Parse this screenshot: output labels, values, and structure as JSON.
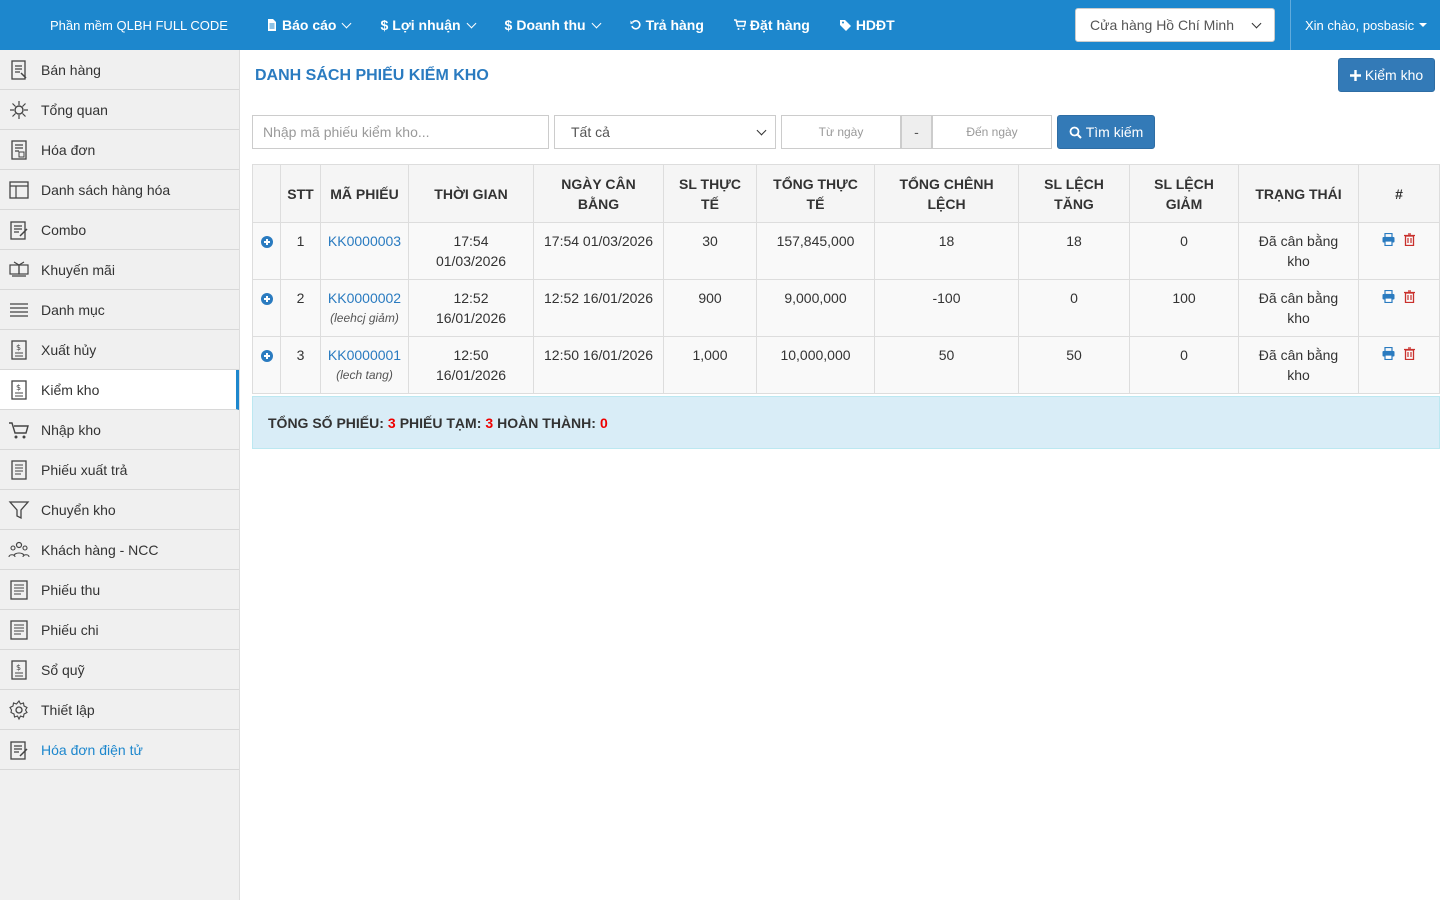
{
  "topbar": {
    "brand": "Phần mềm QLBH FULL CODE",
    "nav": [
      {
        "label": "Báo cáo",
        "icon": "file-icon",
        "dropdown": true
      },
      {
        "label": "Lợi nhuận",
        "icon": "dollar-icon",
        "dropdown": true
      },
      {
        "label": "Doanh thu",
        "icon": "dollar-icon",
        "dropdown": true
      },
      {
        "label": "Trả hàng",
        "icon": "undo-icon",
        "dropdown": false
      },
      {
        "label": "Đặt hàng",
        "icon": "cart-icon",
        "dropdown": false
      },
      {
        "label": "HDĐT",
        "icon": "tag-icon",
        "dropdown": false
      }
    ],
    "store": "Cửa hàng Hồ Chí Minh",
    "greeting": "Xin chào, posbasic"
  },
  "sidebar": {
    "items": [
      {
        "label": "Bán hàng",
        "icon": "sales-icon"
      },
      {
        "label": "Tổng quan",
        "icon": "overview-icon"
      },
      {
        "label": "Hóa đơn",
        "icon": "invoice-icon"
      },
      {
        "label": "Danh sách hàng hóa",
        "icon": "products-icon"
      },
      {
        "label": "Combo",
        "icon": "combo-icon"
      },
      {
        "label": "Khuyến mãi",
        "icon": "promotion-icon"
      },
      {
        "label": "Danh mục",
        "icon": "list-icon"
      },
      {
        "label": "Xuất hủy",
        "icon": "export-cancel-icon"
      },
      {
        "label": "Kiểm kho",
        "icon": "stock-check-icon"
      },
      {
        "label": "Nhập kho",
        "icon": "stock-in-icon"
      },
      {
        "label": "Phiếu xuất trả",
        "icon": "return-slip-icon"
      },
      {
        "label": "Chuyển kho",
        "icon": "transfer-icon"
      },
      {
        "label": "Khách hàng - NCC",
        "icon": "customers-icon"
      },
      {
        "label": "Phiếu thu",
        "icon": "receipt-icon"
      },
      {
        "label": "Phiếu chi",
        "icon": "payment-icon"
      },
      {
        "label": "Sổ quỹ",
        "icon": "cashbook-icon"
      },
      {
        "label": "Thiết lập",
        "icon": "settings-icon"
      },
      {
        "label": "Hóa đơn điện tử",
        "icon": "e-invoice-icon"
      }
    ]
  },
  "main": {
    "title": "DANH SÁCH PHIẾU KIỂM KHO",
    "add_button": "Kiểm kho",
    "filters": {
      "code_placeholder": "Nhập mã phiếu kiểm kho...",
      "status": "Tất cả",
      "from_placeholder": "Từ ngày",
      "separator": "-",
      "to_placeholder": "Đến ngày",
      "search_button": "Tìm kiếm"
    },
    "table": {
      "headers": [
        "STT",
        "MÃ PHIẾU",
        "THỜI GIAN",
        "NGÀY CÂN BẰNG",
        "SL THỰC TẾ",
        "TỔNG THỰC TẾ",
        "TỔNG CHÊNH LỆCH",
        "SL LỆCH TĂNG",
        "SL LỆCH GIẢM",
        "TRẠNG THÁI",
        "#"
      ],
      "rows": [
        {
          "stt": "1",
          "code": "KK0000003",
          "note": "",
          "time_line1": "17:54",
          "time_line2": "01/03/2026",
          "balance_date": "17:54 01/03/2026",
          "qty_actual": "30",
          "total_actual": "157,845,000",
          "total_diff": "18",
          "qty_increase": "18",
          "qty_decrease": "0",
          "status": "Đã cân bằng kho"
        },
        {
          "stt": "2",
          "code": "KK0000002",
          "note": "(leehcj giảm)",
          "time_line1": "12:52",
          "time_line2": "16/01/2026",
          "balance_date": "12:52 16/01/2026",
          "qty_actual": "900",
          "total_actual": "9,000,000",
          "total_diff": "-100",
          "qty_increase": "0",
          "qty_decrease": "100",
          "status": "Đã cân bằng kho"
        },
        {
          "stt": "3",
          "code": "KK0000001",
          "note": "(lech tang)",
          "time_line1": "12:50",
          "time_line2": "16/01/2026",
          "balance_date": "12:50 16/01/2026",
          "qty_actual": "1,000",
          "total_actual": "10,000,000",
          "total_diff": "50",
          "qty_increase": "50",
          "qty_decrease": "0",
          "status": "Đã cân bằng kho"
        }
      ]
    },
    "summary": {
      "total_label": "TỔNG SỐ PHIẾU:",
      "total": "3",
      "draft_label": "PHIẾU TẠM:",
      "draft": "3",
      "done_label": "HOÀN THÀNH:",
      "done": "0"
    },
    "colors": {
      "primary": "#1d87cd",
      "button": "#337ab7",
      "link": "#2a7bc0",
      "delete": "#c9302c",
      "highlight": "#e00000"
    }
  }
}
